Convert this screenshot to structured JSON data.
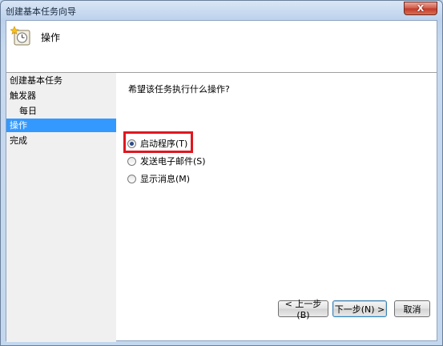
{
  "window": {
    "title": "创建基本任务向导",
    "close_glyph": "X"
  },
  "header": {
    "icon": "task-clock-icon",
    "title": "操作"
  },
  "sidebar": {
    "items": [
      {
        "label": "创建基本任务",
        "active": false
      },
      {
        "label": "触发器",
        "active": false
      },
      {
        "label": "每日",
        "active": false
      },
      {
        "label": "操作",
        "active": true
      },
      {
        "label": "完成",
        "active": false
      }
    ]
  },
  "main": {
    "question": "希望该任务执行什么操作?",
    "options": [
      {
        "label": "启动程序(T)",
        "checked": true
      },
      {
        "label": "发送电子邮件(S)",
        "checked": false
      },
      {
        "label": "显示消息(M)",
        "checked": false
      }
    ]
  },
  "buttons": {
    "back": "< 上一步(B)",
    "next": "下一步(N) >",
    "cancel": "取消"
  },
  "colors": {
    "highlight_box": "#e0171f",
    "selected_item": "#3399ff"
  }
}
